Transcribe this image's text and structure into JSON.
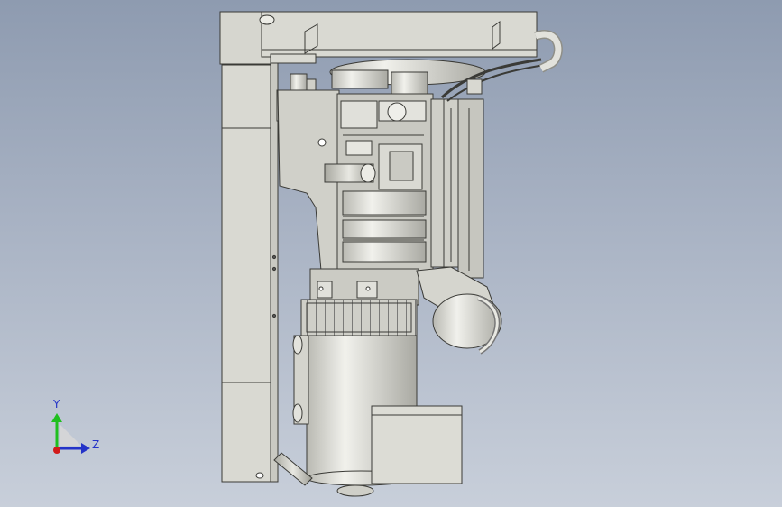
{
  "viewport": {
    "background_top": "#8e9bb0",
    "background_bottom": "#c8cfda",
    "model_fill": "#d9d9d2",
    "model_edge": "#3a3a36"
  },
  "triad": {
    "y_label": "Y",
    "z_label": "Z",
    "y_color": "#1fbf1f",
    "z_color": "#2433c8",
    "x_color": "#d21a1a"
  }
}
